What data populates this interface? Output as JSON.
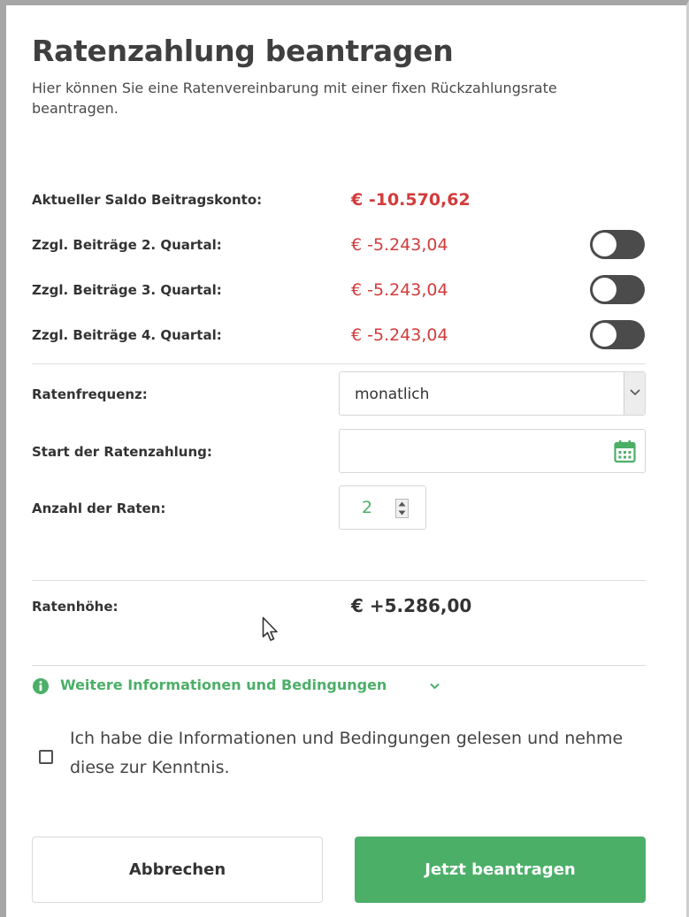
{
  "header": {
    "title": "Ratenzahlung beantragen",
    "subtitle": "Hier können Sie eine Ratenvereinbarung mit einer fixen Rückzahlungsrate beantragen."
  },
  "balance": {
    "label": "Aktueller Saldo Beitragskonto:",
    "value": "€ -10.570,62"
  },
  "quarters": [
    {
      "label": "Zzgl. Beiträge 2. Quartal:",
      "value": "€ -5.243,04",
      "enabled": false
    },
    {
      "label": "Zzgl. Beiträge 3. Quartal:",
      "value": "€ -5.243,04",
      "enabled": false
    },
    {
      "label": "Zzgl. Beiträge 4. Quartal:",
      "value": "€ -5.243,04",
      "enabled": false
    }
  ],
  "form": {
    "frequency_label": "Ratenfrequenz:",
    "frequency_value": "monatlich",
    "start_label": "Start der Ratenzahlung:",
    "start_value": "",
    "count_label": "Anzahl der Raten:",
    "count_value": "2"
  },
  "rate": {
    "label": "Ratenhöhe:",
    "value": "€ +5.286,00"
  },
  "info": {
    "link_label": "Weitere Informationen und Bedingungen"
  },
  "consent": {
    "text": "Ich habe die Informationen und Bedingungen gelesen und nehme diese zur Kenntnis.",
    "checked": false
  },
  "buttons": {
    "cancel_label": "Abbrechen",
    "submit_label": "Jetzt beantragen"
  },
  "colors": {
    "accent_green": "#4caf68",
    "negative_red": "#d23b3b",
    "toggle_off": "#4b4b4b"
  },
  "icons": [
    "chevron-down-icon",
    "calendar-icon",
    "spinner-arrows-icon",
    "info-circle-icon",
    "mouse-cursor-icon"
  ]
}
